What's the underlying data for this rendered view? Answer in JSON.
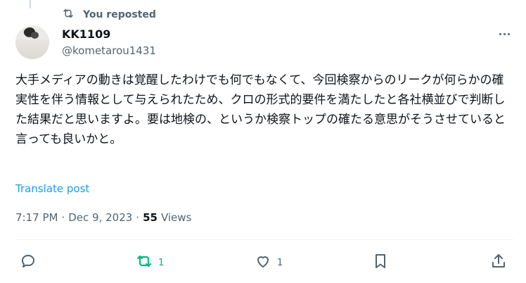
{
  "repost_header": {
    "label": "You reposted"
  },
  "author": {
    "display_name": "KK1109",
    "handle": "@kometarou1431"
  },
  "post": {
    "text": "大手メディアの動きは覚醒したわけでも何でもなくて、今回検察からのリークが何らかの確実性を伴う情報として与えられたため、クロの形式的要件を満たしたと各社横並びで判断した結果だと思いますよ。要は地検の、というか検察トップの確たる意思がそうさせていると言っても良いかと。",
    "translate_label": "Translate post"
  },
  "meta": {
    "time": "7:17 PM",
    "separator": "·",
    "date": "Dec 9, 2023",
    "views_count": "55",
    "views_label": "Views"
  },
  "actions": {
    "reply": {
      "icon": "reply-icon",
      "count": ""
    },
    "repost": {
      "icon": "repost-icon",
      "count": "1",
      "active": true
    },
    "like": {
      "icon": "heart-icon",
      "count": "1"
    },
    "bookmark": {
      "icon": "bookmark-icon"
    },
    "share": {
      "icon": "share-icon"
    }
  },
  "colors": {
    "link": "#1d9bf0",
    "repost_active": "#00ba7c",
    "muted": "#536471",
    "text": "#0f1419"
  }
}
